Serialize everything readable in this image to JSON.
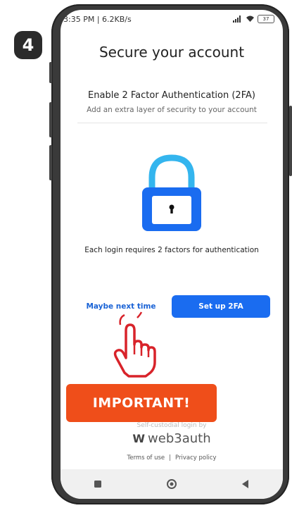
{
  "step": {
    "number": "4"
  },
  "status_bar": {
    "time": "3:35 PM | 6.2KB/s",
    "battery": "37"
  },
  "page": {
    "title": "Secure your account",
    "heading": "Enable 2 Factor Authentication (2FA)",
    "subheading": "Add an extra layer of security to your account",
    "explanation": "Each login requires 2 factors for authentication"
  },
  "actions": {
    "secondary_label": "Maybe next time",
    "primary_label": "Set up 2FA"
  },
  "callout": {
    "label": "IMPORTANT!"
  },
  "footer": {
    "tagline": "Self-custodial login by",
    "brand_mark": "W",
    "brand_name": "web3auth",
    "terms_label": "Terms of use",
    "separator": "|",
    "privacy_label": "Privacy policy"
  },
  "icons": {
    "lock": "lock-icon",
    "pointer": "hand-pointer-icon",
    "nav_recents": "square-icon",
    "nav_home": "circle-icon",
    "nav_back": "triangle-back-icon"
  },
  "colors": {
    "primary": "#1a6cf0",
    "link": "#1a63d6",
    "callout": "#ef4e1a",
    "lock_shackle": "#34b5ee",
    "lock_body": "#1a6cf0",
    "hand_outline": "#d8232a"
  }
}
